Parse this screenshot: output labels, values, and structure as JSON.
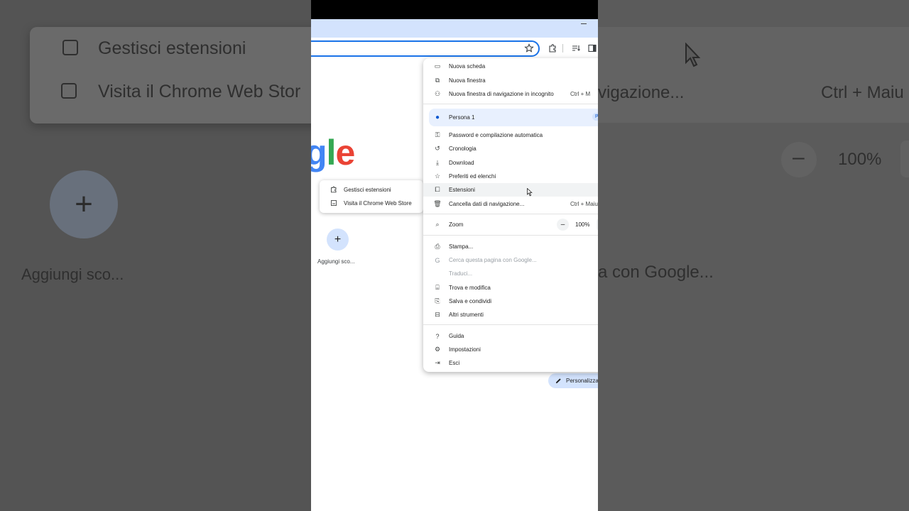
{
  "background": {
    "left": {
      "manage_extensions": "Gestisci estensioni",
      "visit_store": "Visita il Chrome Web Stor",
      "add_shortcut": "Aggiungi sco..."
    },
    "right": {
      "incognito_fragment": "vigazione...",
      "shortcut_fragment": "Ctrl + Maiu",
      "zoom_minus": "–",
      "zoom_value": "100%",
      "google_fragment": "a con Google..."
    }
  },
  "browser": {
    "minimize_glyph": "–",
    "logo": {
      "g": "g",
      "l": "l",
      "e": "e"
    },
    "shortcut": {
      "plus": "+",
      "label": "Aggiungi sco..."
    },
    "customize_label": "Personalizza"
  },
  "submenu": {
    "items": [
      {
        "label": "Gestisci estensioni",
        "icon": "puzzle-icon"
      },
      {
        "label": "Visita il Chrome Web Store",
        "icon": "web-store-icon"
      }
    ]
  },
  "menu": {
    "new_tab": "Nuova scheda",
    "new_window": "Nuova finestra",
    "incognito": "Nuova finestra di navigazione in incognito",
    "incognito_shortcut": "Ctrl + M",
    "profile": "Persona 1",
    "profile_badge": "Per",
    "passwords": "Password e compilazione automatica",
    "history": "Cronologia",
    "downloads": "Download",
    "bookmarks": "Preferiti ed elenchi",
    "extensions": "Estensioni",
    "clear_data": "Cancella dati di navigazione...",
    "clear_data_shortcut": "Ctrl + Maiu",
    "zoom": "Zoom",
    "zoom_minus": "–",
    "zoom_value": "100%",
    "print": "Stampa...",
    "search_google": "Cerca questa pagina con Google...",
    "translate": "Traduci...",
    "find_edit": "Trova e modifica",
    "save_share": "Salva e condividi",
    "more_tools": "Altri strumenti",
    "help": "Guida",
    "settings": "Impostazioni",
    "exit": "Esci"
  }
}
